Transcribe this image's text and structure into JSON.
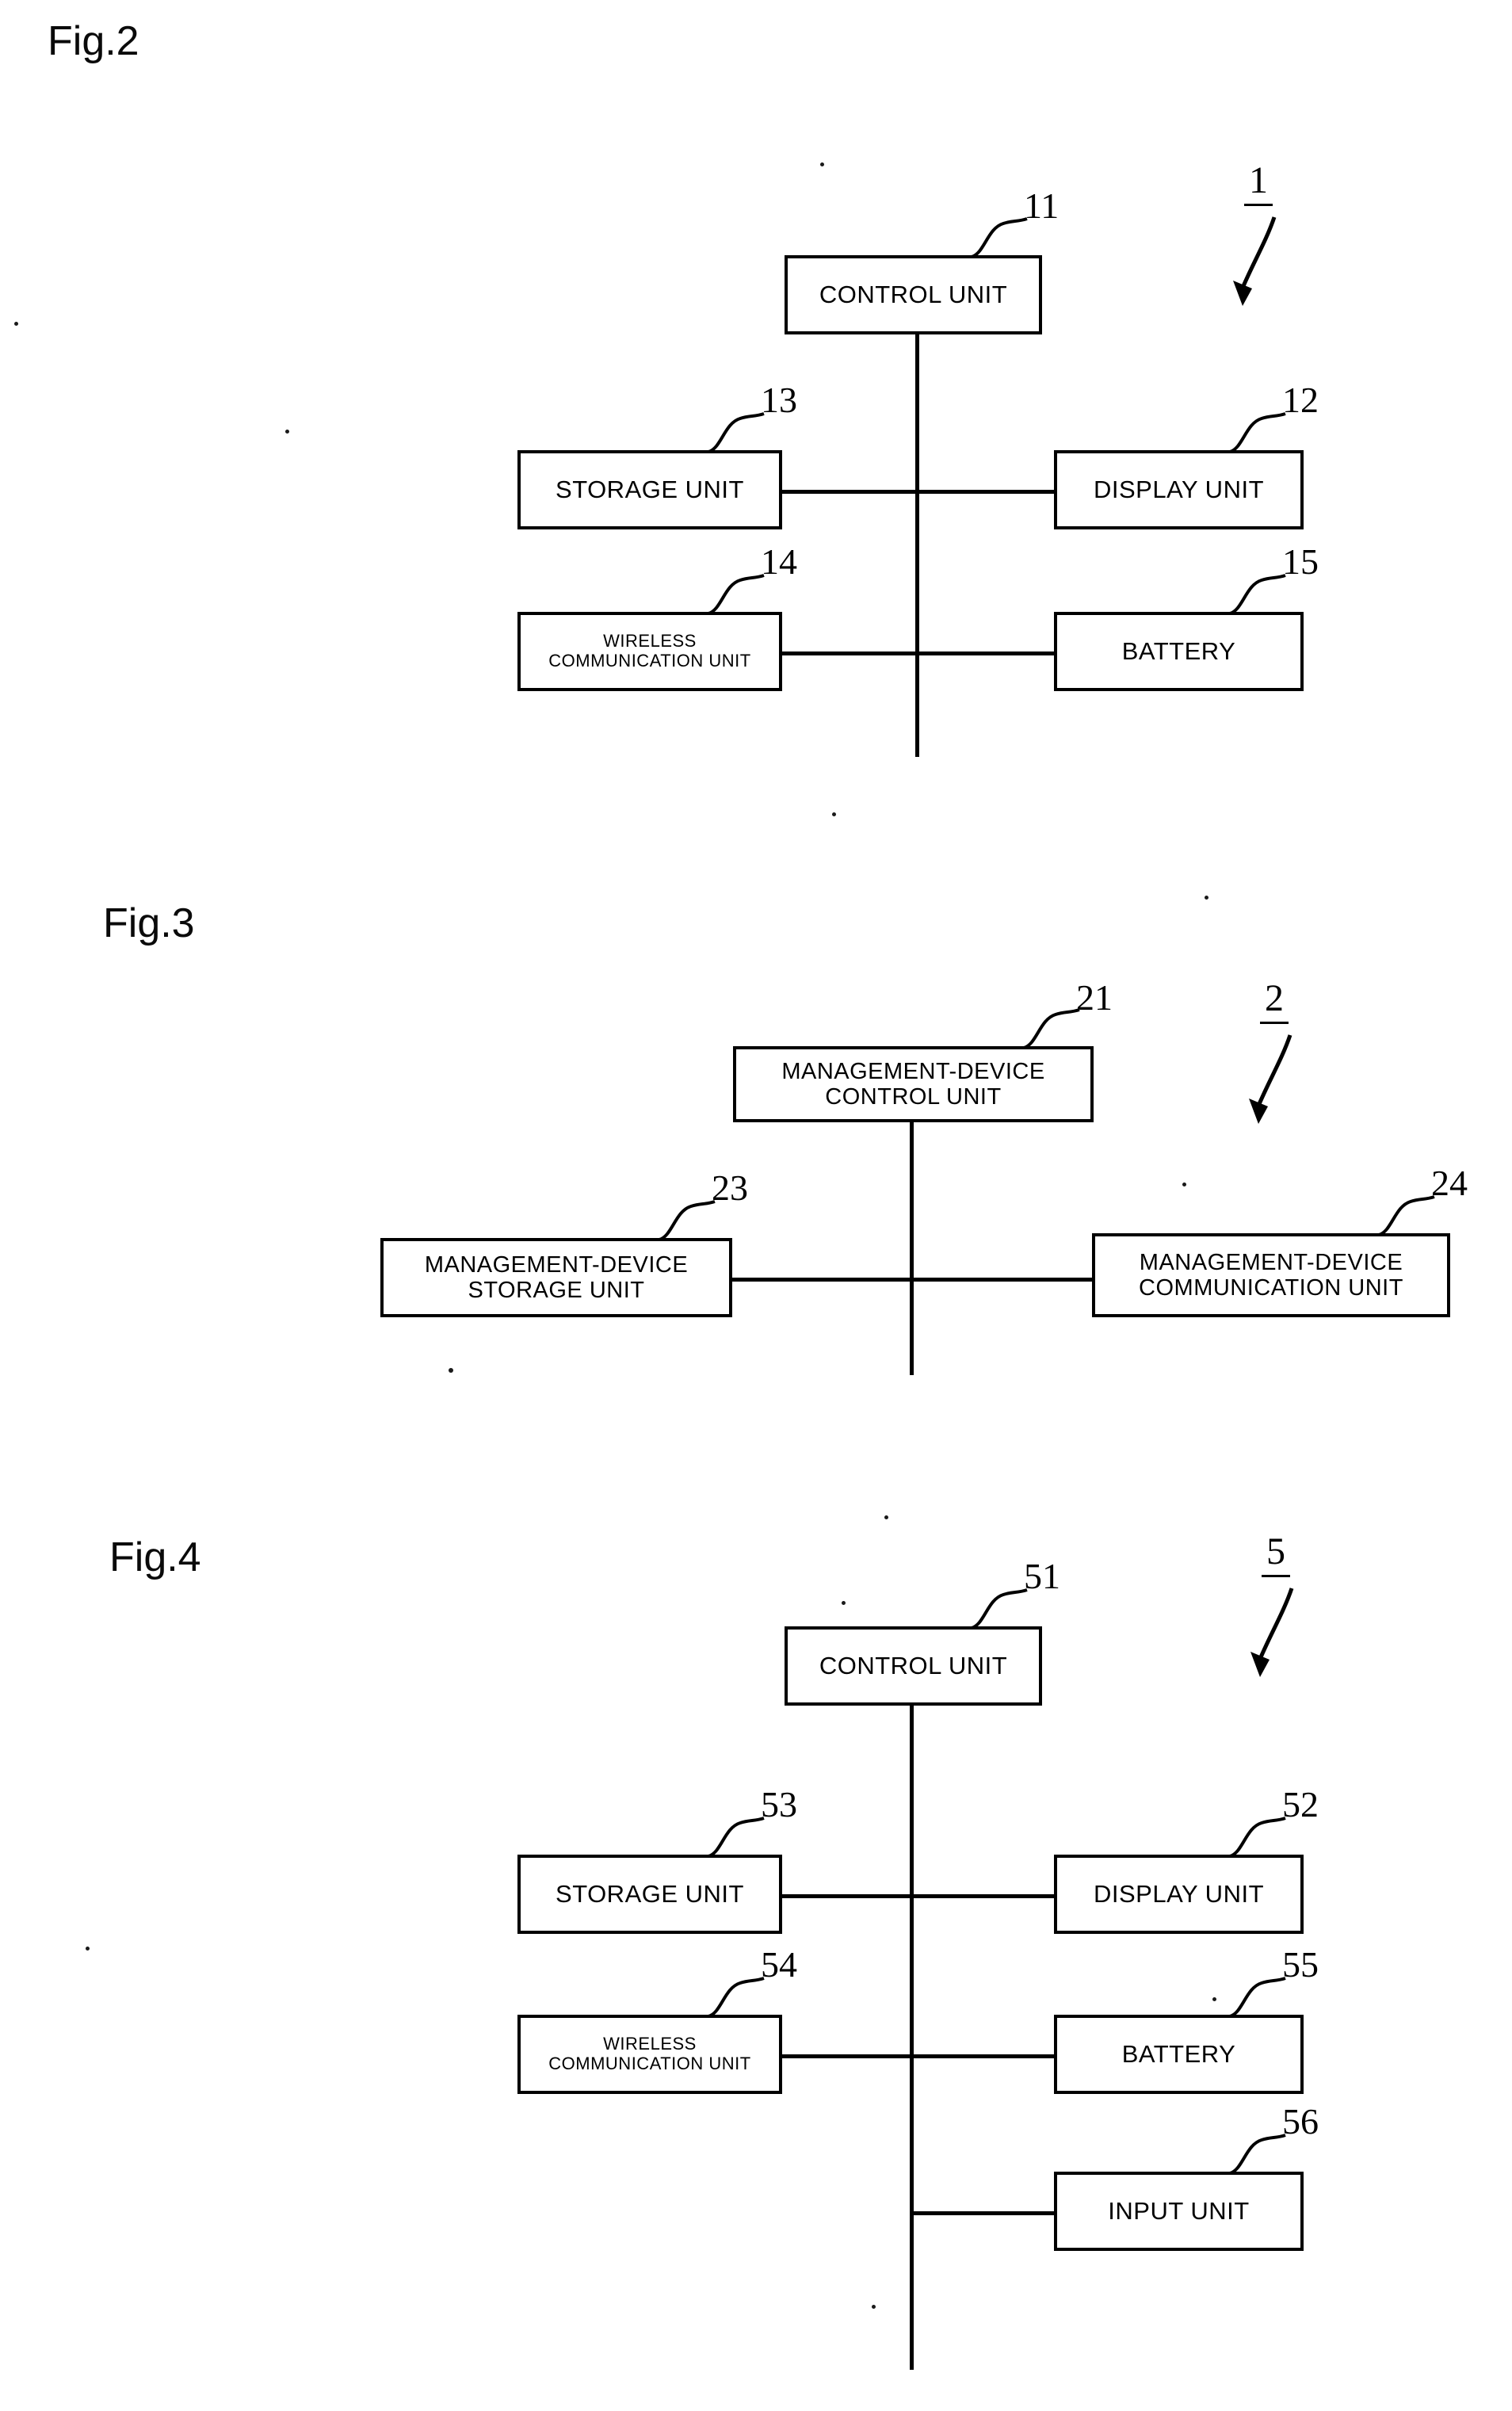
{
  "document": {
    "type": "patent-drawing-sheet",
    "background_color": "#ffffff",
    "line_color": "#000000"
  },
  "figures": [
    {
      "id": "fig2",
      "title": "Fig.2",
      "reference_numeral": "1",
      "boxes": [
        {
          "id": "fig2-control-unit",
          "label": "CONTROL UNIT",
          "lead": "11"
        },
        {
          "id": "fig2-storage-unit",
          "label": "STORAGE UNIT",
          "lead": "13"
        },
        {
          "id": "fig2-display-unit",
          "label": "DISPLAY UNIT",
          "lead": "12"
        },
        {
          "id": "fig2-wireless-comm-unit",
          "label": "WIRELESS\nCOMMUNICATION UNIT",
          "lead": "14"
        },
        {
          "id": "fig2-battery",
          "label": "BATTERY",
          "lead": "15"
        }
      ]
    },
    {
      "id": "fig3",
      "title": "Fig.3",
      "reference_numeral": "2",
      "boxes": [
        {
          "id": "fig3-md-control-unit",
          "label": "MANAGEMENT-DEVICE\nCONTROL UNIT",
          "lead": "21"
        },
        {
          "id": "fig3-md-storage-unit",
          "label": "MANAGEMENT-DEVICE\nSTORAGE UNIT",
          "lead": "23"
        },
        {
          "id": "fig3-md-comm-unit",
          "label": "MANAGEMENT-DEVICE\nCOMMUNICATION UNIT",
          "lead": "24"
        }
      ]
    },
    {
      "id": "fig4",
      "title": "Fig.4",
      "reference_numeral": "5",
      "boxes": [
        {
          "id": "fig4-control-unit",
          "label": "CONTROL UNIT",
          "lead": "51"
        },
        {
          "id": "fig4-storage-unit",
          "label": "STORAGE UNIT",
          "lead": "53"
        },
        {
          "id": "fig4-display-unit",
          "label": "DISPLAY UNIT",
          "lead": "52"
        },
        {
          "id": "fig4-wireless-comm-unit",
          "label": "WIRELESS\nCOMMUNICATION UNIT",
          "lead": "54"
        },
        {
          "id": "fig4-battery",
          "label": "BATTERY",
          "lead": "55"
        },
        {
          "id": "fig4-input-unit",
          "label": "INPUT UNIT",
          "lead": "56"
        }
      ]
    }
  ]
}
